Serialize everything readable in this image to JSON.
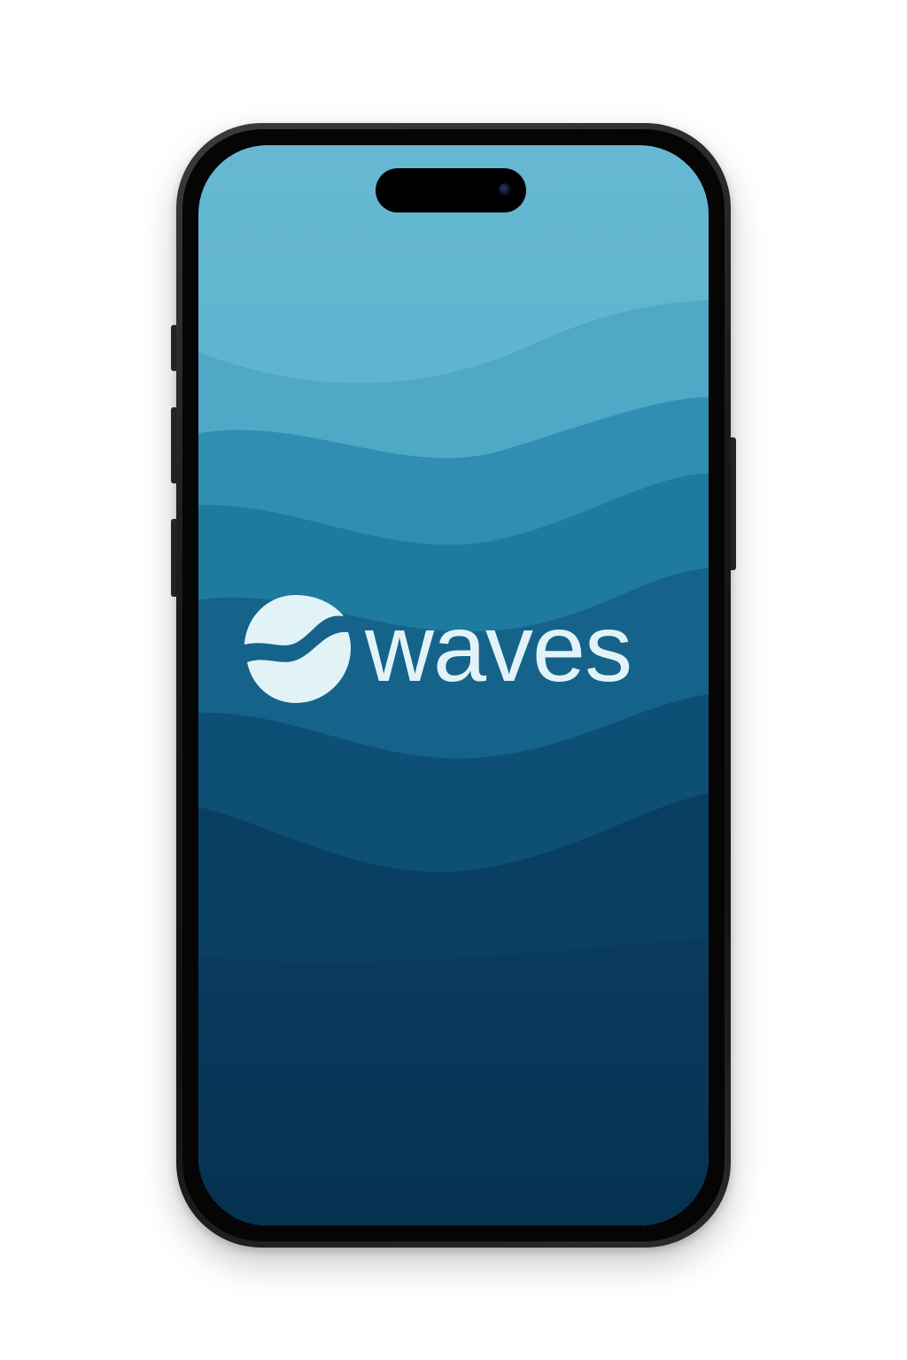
{
  "app": {
    "brand_name": "waves",
    "logo_icon": "wave-circle-icon"
  },
  "colors": {
    "sky_top": "#66b8d2",
    "band_1": "#4fa8c6",
    "band_2": "#2f8eb1",
    "band_3": "#1f7aa0",
    "band_4": "#15638a",
    "band_5": "#0e4f76",
    "band_6": "#0a3f64",
    "deep": "#06304f",
    "logo_color": "#e2f3f7",
    "phone_frame": "#1b1b1d"
  }
}
